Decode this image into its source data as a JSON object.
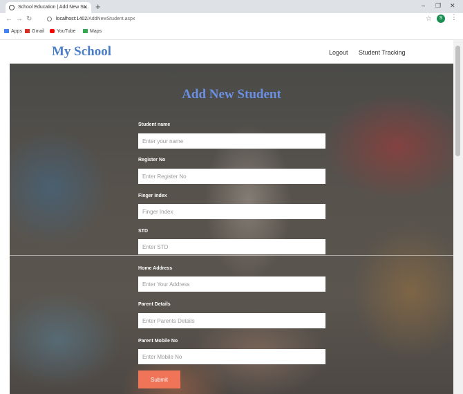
{
  "browser": {
    "tab_title": "School Education | Add New St...",
    "url_host": "localhost:1402",
    "url_path": "/AddNewStudent.aspx",
    "profile_initial": "S",
    "bookmarks": [
      {
        "label": "Apps",
        "icon": "apps-icon",
        "color": "#4285f4"
      },
      {
        "label": "Gmail",
        "icon": "gmail-icon",
        "color": "#d93025"
      },
      {
        "label": "YouTube",
        "icon": "youtube-icon",
        "color": "#ff0000"
      },
      {
        "label": "Maps",
        "icon": "maps-icon",
        "color": "#34a853"
      }
    ]
  },
  "site": {
    "brand": "My School",
    "nav": {
      "logout": "Logout",
      "tracking": "Student Tracking"
    },
    "brand_color": "#4a7dc8"
  },
  "form": {
    "title": "Add New Student",
    "fields": [
      {
        "label": "Student name",
        "placeholder": "Enter your name"
      },
      {
        "label": "Register No",
        "placeholder": "Enter Register No"
      },
      {
        "label": "Finger Index",
        "placeholder": "Finger Index"
      },
      {
        "label": "STD",
        "placeholder": "Enter STD"
      },
      {
        "label": "Home Address",
        "placeholder": "Enter Your Address"
      },
      {
        "label": "Parent Details",
        "placeholder": "Enter Parents Details"
      },
      {
        "label": "Parent Mobile No",
        "placeholder": "Enter Mobile No"
      }
    ],
    "submit_label": "Submit",
    "submit_color": "#f07558"
  }
}
